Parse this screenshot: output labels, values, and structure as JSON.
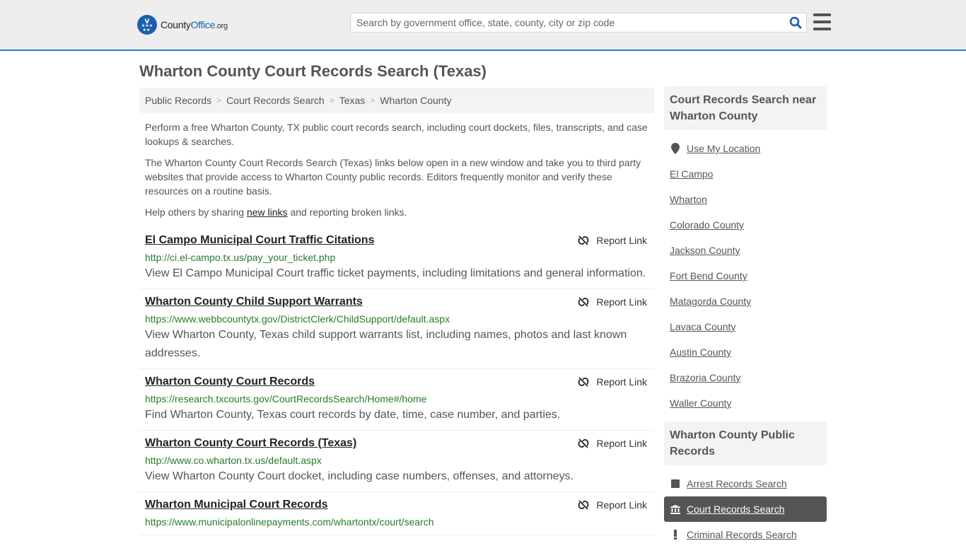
{
  "header": {
    "logo": {
      "part1": "County",
      "part2": "Office",
      "part3": ".org"
    },
    "search_placeholder": "Search by government office, state, county, city or zip code",
    "search_value": ""
  },
  "page_title": "Wharton County Court Records Search (Texas)",
  "breadcrumb": [
    {
      "label": "Public Records"
    },
    {
      "label": "Court Records Search"
    },
    {
      "label": "Texas"
    },
    {
      "label": "Wharton County"
    }
  ],
  "breadcrumb_separator": ">",
  "intro": {
    "p1": "Perform a free Wharton County, TX public court records search, including court dockets, files, transcripts, and case lookups & searches.",
    "p2": "The Wharton County Court Records Search (Texas) links below open in a new window and take you to third party websites that provide access to Wharton County public records. Editors frequently monitor and verify these resources on a routine basis.",
    "p3_before": "Help others by sharing ",
    "p3_link": "new links",
    "p3_after": " and reporting broken links."
  },
  "report_label": "Report Link",
  "results": [
    {
      "title": "El Campo Municipal Court Traffic Citations",
      "url": "http://ci.el-campo.tx.us/pay_your_ticket.php",
      "description": "View El Campo Municipal Court traffic ticket payments, including limitations and general information."
    },
    {
      "title": "Wharton County Child Support Warrants",
      "url": "https://www.webbcountytx.gov/DistrictClerk/ChildSupport/default.aspx",
      "description": "View Wharton County, Texas child support warrants list, including names, photos and last known addresses."
    },
    {
      "title": "Wharton County Court Records",
      "url": "https://research.txcourts.gov/CourtRecordsSearch/Home#/home",
      "description": "Find Wharton County, Texas court records by date, time, case number, and parties."
    },
    {
      "title": "Wharton County Court Records (Texas)",
      "url": "http://www.co.wharton.tx.us/default.aspx",
      "description": "View Wharton County Court docket, including case numbers, offenses, and attorneys."
    },
    {
      "title": "Wharton Municipal Court Records",
      "url": "https://www.municipalonlinepayments.com/whartontx/court/search",
      "description": ""
    }
  ],
  "sidebar": {
    "nearby": {
      "heading": "Court Records Search near Wharton County",
      "use_location": "Use My Location",
      "items": [
        "El Campo",
        "Wharton",
        "Colorado County",
        "Jackson County",
        "Fort Bend County",
        "Matagorda County",
        "Lavaca County",
        "Austin County",
        "Brazoria County",
        "Waller County"
      ]
    },
    "public_records": {
      "heading": "Wharton County Public Records",
      "items": [
        {
          "label": "Arrest Records Search",
          "icon": "square-icon",
          "active": false
        },
        {
          "label": "Court Records Search",
          "icon": "courthouse-icon",
          "active": true
        },
        {
          "label": "Criminal Records Search",
          "icon": "exclamation-icon",
          "active": false
        }
      ]
    }
  },
  "colors": {
    "brand_blue": "#1b5fae",
    "header_bg": "#eeeeee",
    "header_border": "#2f7bbf",
    "url_green": "#2a7a2a",
    "active_bg": "#555555"
  }
}
